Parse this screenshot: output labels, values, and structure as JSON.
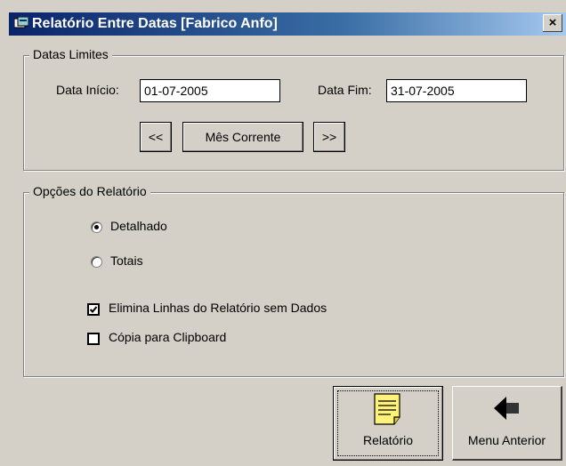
{
  "window": {
    "title": "Relatório Entre Datas [Fabrico Anfo]",
    "close": "×"
  },
  "dates": {
    "legend": "Datas Limites",
    "start_label": "Data Início:",
    "start_value": "01-07-2005",
    "end_label": "Data Fim:",
    "end_value": "31-07-2005",
    "prev_label": "<<",
    "current_label": "Mês Corrente",
    "next_label": ">>"
  },
  "options": {
    "legend": "Opções do Relatório",
    "detail_label": "Detalhado",
    "totals_label": "Totais",
    "selected": "Detalhado",
    "eliminate_label": "Elimina Linhas do Relatório sem Dados",
    "eliminate_checked": true,
    "clipboard_label": "Cópia para Clipboard",
    "clipboard_checked": false
  },
  "actions": {
    "report_label": "Relatório",
    "back_label": "Menu Anterior"
  },
  "colors": {
    "titlebar": "#0a246a",
    "face": "#d4d0c8",
    "report_icon": "#fff27a"
  }
}
